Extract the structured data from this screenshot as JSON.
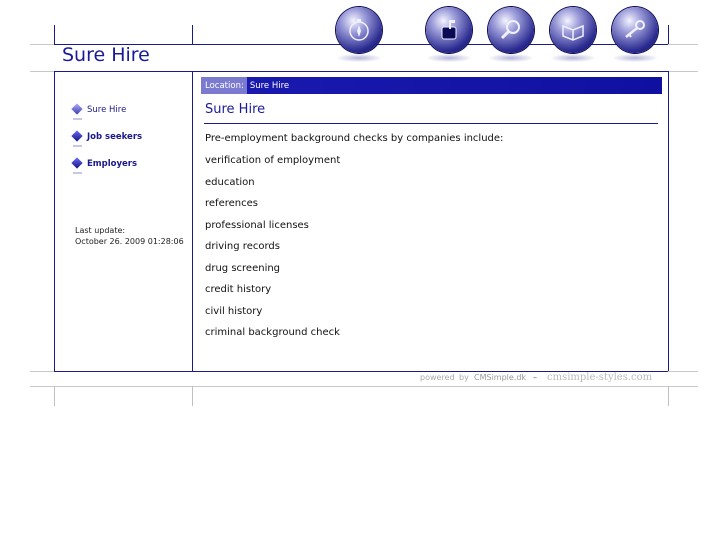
{
  "site": {
    "title": "Sure Hire"
  },
  "toolbar": {
    "icons": [
      "compass-icon",
      "mailbox-icon",
      "magnifier-icon",
      "book-icon",
      "key-icon"
    ]
  },
  "sidebar": {
    "items": [
      {
        "label": "Sure Hire",
        "active": true
      },
      {
        "label": "Job seekers",
        "active": false
      },
      {
        "label": "Employers",
        "active": false
      }
    ],
    "last_update_label": "Last update:",
    "last_update_value": "October 26. 2009 01:28:06"
  },
  "location": {
    "label": "Location:",
    "value": "Sure Hire"
  },
  "main": {
    "heading": "Sure Hire",
    "intro": "Pre-employment background checks by companies include:",
    "items": [
      "verification of employment",
      "education",
      "references",
      "professional licenses",
      "driving records",
      "drug screening",
      "credit history",
      "civil history",
      "criminal background check"
    ]
  },
  "footer": {
    "powered": "powered",
    "by": "by",
    "cmsimple": "CMSimple.dk",
    "dash": "–",
    "styles": "cmsimple-styles.com"
  },
  "colors": {
    "accent": "#1a1a9a",
    "bar": "#1010a0",
    "label_bg": "#7a7ad0"
  }
}
